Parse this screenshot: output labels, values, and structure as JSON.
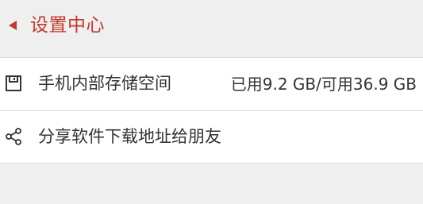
{
  "header": {
    "title": "设置中心",
    "back_icon": "back-arrow-icon",
    "accent_color": "#c0392b"
  },
  "settings": {
    "items": [
      {
        "icon": "storage-icon",
        "label": "手机内部存储空间",
        "value": "已用9.2 GB/可用36.9 GB"
      },
      {
        "icon": "share-icon",
        "label": "分享软件下载地址给朋友"
      }
    ]
  }
}
